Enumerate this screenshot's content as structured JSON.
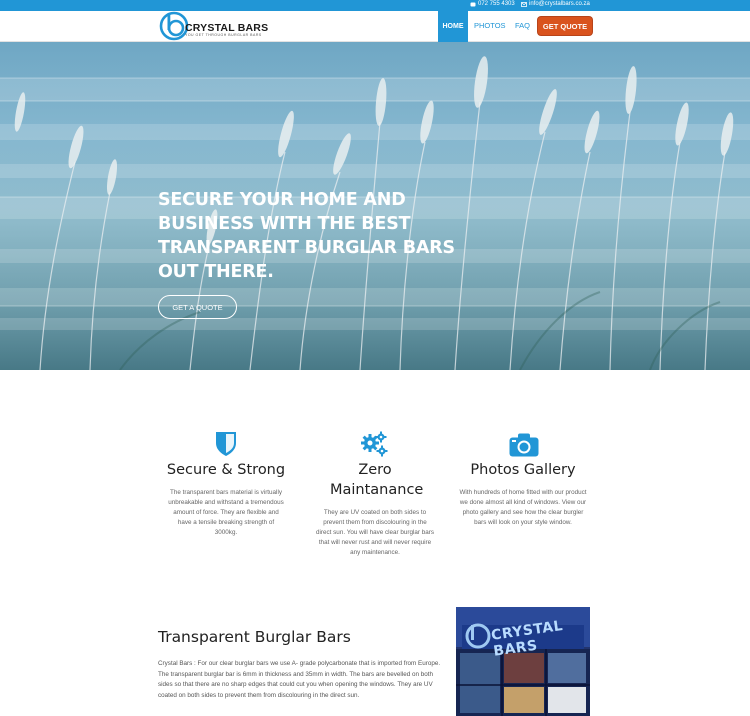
{
  "topbar": {
    "phone": "072 755 4303",
    "email": "info@crystalbars.co.za"
  },
  "brand": {
    "name": "CRYSTAL BARS",
    "tagline": "YOU GET THROUGH BURGLAR BARS"
  },
  "nav": {
    "items": [
      {
        "label": "HOME"
      },
      {
        "label": "PHOTOS"
      },
      {
        "label": "FAQ"
      }
    ],
    "cta": "GET QUOTE"
  },
  "hero": {
    "title": "SECURE YOUR HOME AND BUSINESS WITH THE BEST TRANSPARENT BURGLAR BARS OUT THERE.",
    "button": "GET A QUOTE"
  },
  "features": [
    {
      "icon": "shield-icon",
      "title": "Secure & Strong",
      "description": "The transparent bars material is virtually unbreakable and withstand a tremendous amount of force. They are flexible and have a tensile breaking strength of 3000kg."
    },
    {
      "icon": "gears-icon",
      "title": "Zero Maintanance",
      "description": "They are UV coated on both sides to prevent them from discolouring in the direct sun. You will have clear burglar bars that will never rust and will never require any maintenance."
    },
    {
      "icon": "camera-icon",
      "title": "Photos Gallery",
      "description": "With hundreds of home fitted with our product we done almost all kind of windows. View our photo gallery and see how the clear burgler bars will look on your style window."
    }
  ],
  "section": {
    "title": "Transparent Burglar Bars",
    "body": "Crystal Bars : For our clear burglar bars we use A- grade polycarbonate that is imported from Europe. The transparent burglar bar is 6mm in thickness and 35mm in width. The bars are bevelled on both sides so that there are no sharp edges that could cut you when opening the windows. They are UV coated on both sides to prevent them from discolouring in the direct sun.",
    "photo_sign": "CRYSTAL BARS"
  },
  "colors": {
    "accent": "#2196d6",
    "cta": "#d9531e"
  }
}
